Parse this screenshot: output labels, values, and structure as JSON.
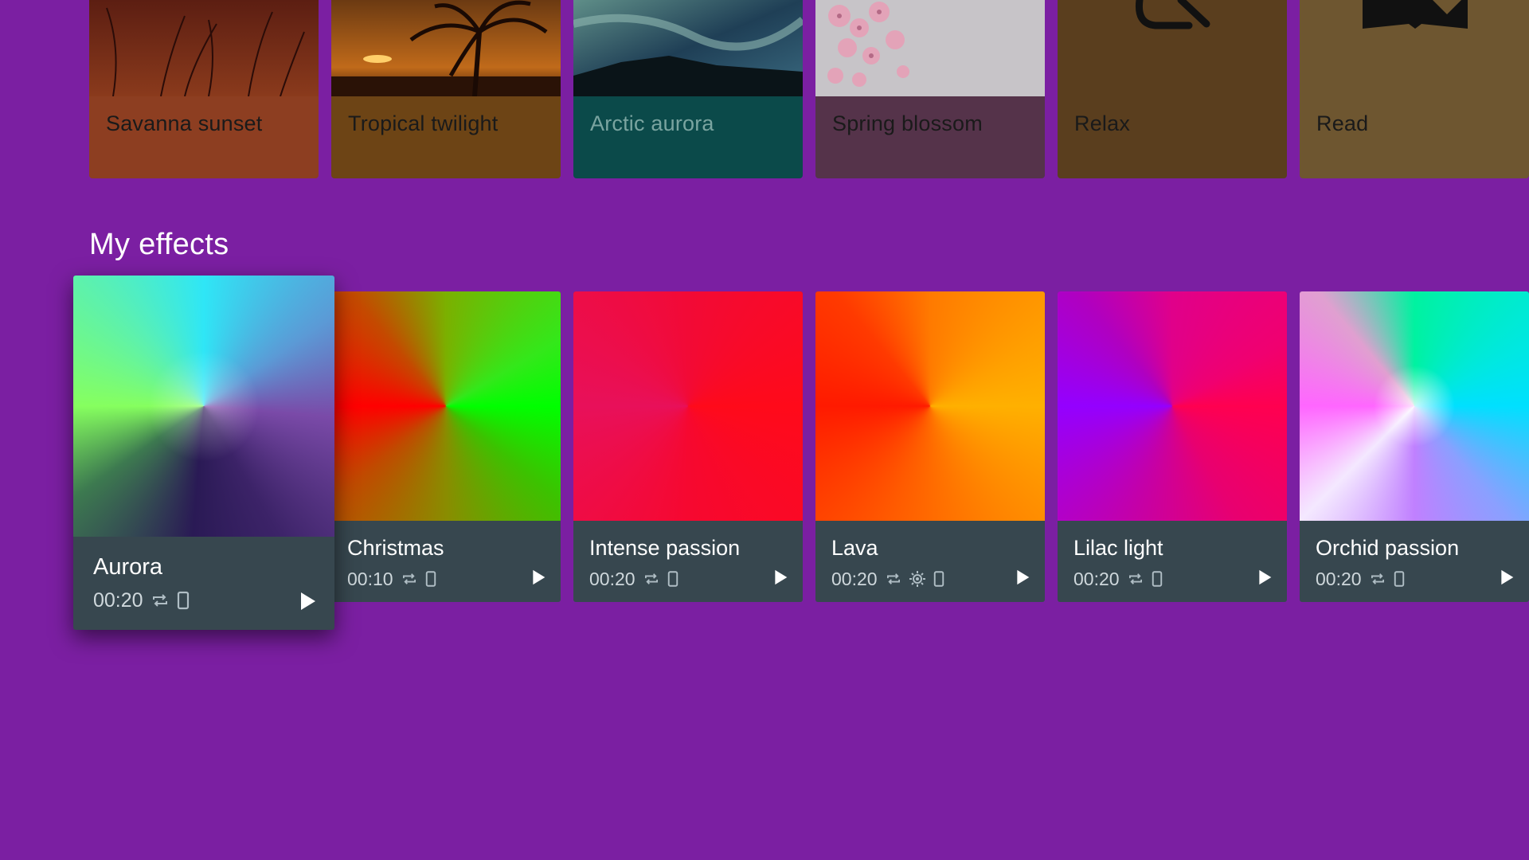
{
  "scenes": [
    {
      "label": "Savanna sunset",
      "color": "#8d3e21"
    },
    {
      "label": "Tropical twilight",
      "color": "#6d4415"
    },
    {
      "label": "Arctic aurora",
      "color": "#0b4a4a"
    },
    {
      "label": "Spring blossom",
      "color": "#55334a"
    },
    {
      "label": "Relax",
      "icon": "lounge-chair-icon",
      "color": "#5a3e1e"
    },
    {
      "label": "Read",
      "icon": "open-book-icon",
      "color": "#6e5630"
    }
  ],
  "section": {
    "title": "My effects"
  },
  "effects": [
    {
      "name": "Aurora",
      "duration": "00:20",
      "icons": [
        "repeat-icon",
        "phone-icon"
      ]
    },
    {
      "name": "Christmas",
      "duration": "00:10",
      "icons": [
        "repeat-icon",
        "phone-icon"
      ]
    },
    {
      "name": "Intense passion",
      "duration": "00:20",
      "icons": [
        "repeat-icon",
        "phone-icon"
      ]
    },
    {
      "name": "Lava",
      "duration": "00:20",
      "icons": [
        "repeat-icon",
        "brightness-icon",
        "phone-icon"
      ]
    },
    {
      "name": "Lilac light",
      "duration": "00:20",
      "icons": [
        "repeat-icon",
        "phone-icon"
      ]
    },
    {
      "name": "Orchid passion",
      "duration": "00:20",
      "icons": [
        "repeat-icon",
        "phone-icon"
      ]
    }
  ],
  "colors": {
    "background": "#7b1fa2",
    "card": "#37474f",
    "text_muted": "#cfd8dc"
  }
}
